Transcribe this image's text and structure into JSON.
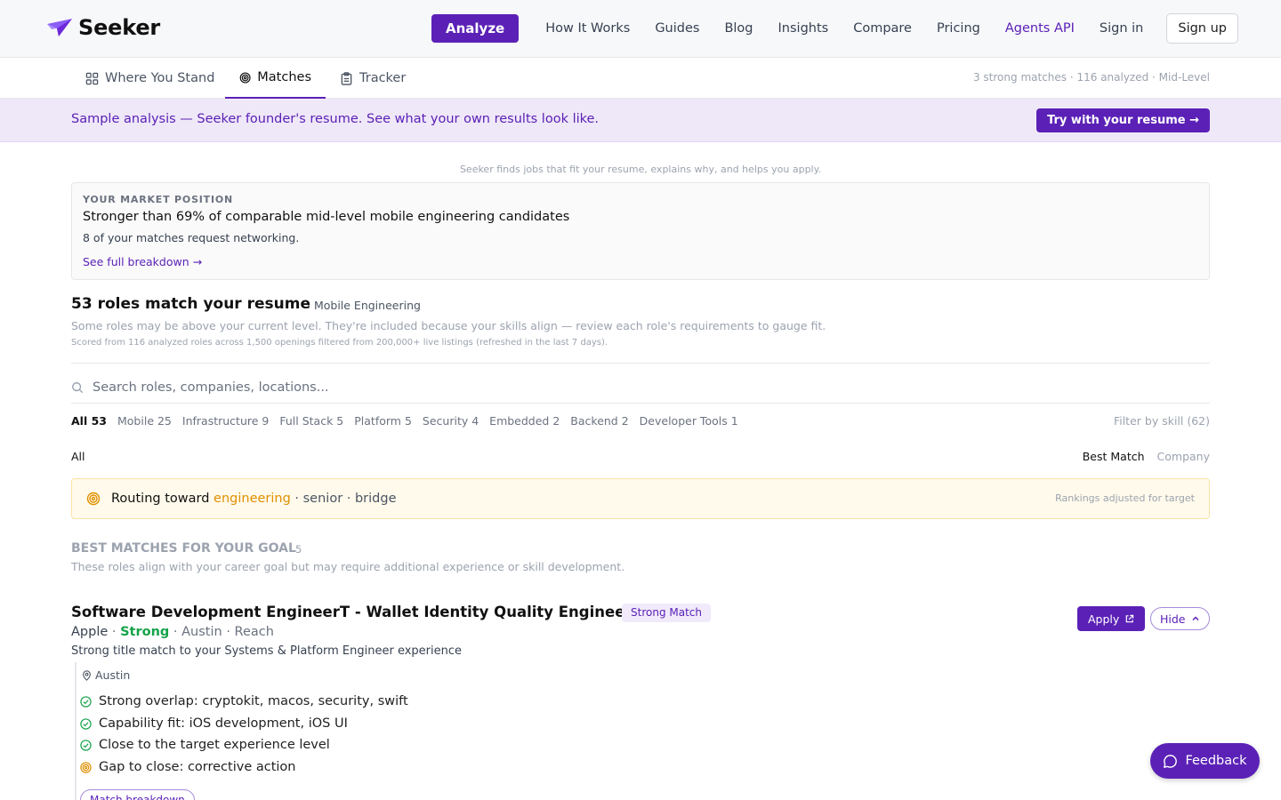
{
  "colors": {
    "accent": "#5b21b6",
    "success": "#16a34a",
    "warning": "#e09000",
    "banner_bg": "#efe8f8"
  },
  "header": {
    "logo_text": "Seeker",
    "analyze_label": "Analyze",
    "nav": [
      "How It Works",
      "Guides",
      "Blog",
      "Insights",
      "Compare",
      "Pricing",
      "Agents API",
      "Sign in"
    ],
    "signup_label": "Sign up"
  },
  "tabs": {
    "items": [
      {
        "label": "Where You Stand",
        "icon": "grid-icon"
      },
      {
        "label": "Matches",
        "icon": "target-icon",
        "active": true
      },
      {
        "label": "Tracker",
        "icon": "clipboard-icon"
      }
    ],
    "meta": "3 strong matches · 116 analyzed · Mid-Level"
  },
  "banner": {
    "text": "Sample analysis — Seeker founder's resume. See what your own results look like.",
    "button": "Try with your resume →"
  },
  "tagline": "Seeker finds jobs that fit your resume, explains why, and helps you apply.",
  "market": {
    "label": "YOUR MARKET POSITION",
    "headline": "Stronger than 69% of comparable mid-level mobile engineering candidates",
    "sub": "8 of your matches request networking.",
    "link": "See full breakdown →"
  },
  "results": {
    "title": "53 roles match your resume",
    "tag": "· Mobile Engineering",
    "note": "Some roles may be above your current level. They're included because your skills align — review each role's requirements to gauge fit.",
    "fine": "Scored from 116 analyzed roles across 1,500 openings filtered from 200,000+ live listings (refreshed in the last 7 days)."
  },
  "search": {
    "placeholder": "Search roles, companies, locations..."
  },
  "filters": {
    "items": [
      "All 53",
      "Mobile 25",
      "Infrastructure 9",
      "Full Stack 5",
      "Platform 5",
      "Security 4",
      "Embedded 2",
      "Backend 2",
      "Developer Tools 1"
    ],
    "skill_filter": "Filter by skill (62)"
  },
  "list": {
    "all_label": "All",
    "sort_best": "Best Match",
    "sort_company": "Company"
  },
  "routing": {
    "prefix": "Routing toward ",
    "highlight": "engineering",
    "suffix": " · senior · bridge",
    "note": "Rankings adjusted for target"
  },
  "section": {
    "title": "BEST MATCHES FOR YOUR GOAL",
    "count": "5",
    "sub": "These roles align with your career goal but may require additional experience or skill development."
  },
  "job": {
    "title": "Software Development EngineerT - Wallet Identity Quality Engineer",
    "badge": "Strong Match",
    "company": "Apple",
    "strength": "Strong",
    "location_meta": "Austin",
    "tier": "Reach",
    "description": "Strong title match to your Systems & Platform Engineer experience",
    "location": "Austin",
    "apply_label": "Apply",
    "hide_label": "Hide",
    "reasons": [
      {
        "text": "Strong overlap: cryptokit, macos, security, swift",
        "icon": "check-circle-icon"
      },
      {
        "text": "Capability fit: iOS development, iOS UI",
        "icon": "check-circle-icon"
      },
      {
        "text": "Close to the target experience level",
        "icon": "check-circle-icon"
      },
      {
        "text": "Gap to close: corrective action",
        "icon": "target-icon"
      }
    ],
    "breakdown_label": "Match breakdown"
  },
  "feedback_label": "Feedback"
}
